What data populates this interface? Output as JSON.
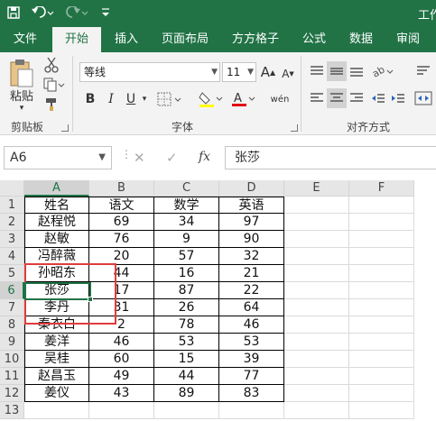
{
  "titlebar": {
    "title": "工作",
    "save_icon": "save-icon",
    "undo_icon": "undo-icon",
    "redo_icon": "redo-icon",
    "customize_icon": "customize-qat-icon"
  },
  "tabs": [
    "文件",
    "开始",
    "插入",
    "页面布局",
    "方方格子",
    "公式",
    "数据",
    "审阅"
  ],
  "active_tab": "开始",
  "ribbon": {
    "clipboard": {
      "paste_label": "粘贴",
      "group_label": "剪贴板"
    },
    "font": {
      "font_name": "等线",
      "font_size": "11",
      "group_label": "字体",
      "bold": "B",
      "italic": "I",
      "underline": "U",
      "grow": "A",
      "shrink": "A",
      "phonetic": "wén"
    },
    "alignment": {
      "group_label": "对齐方式"
    }
  },
  "formula_bar": {
    "name_box": "A6",
    "cancel": "✕",
    "enter": "✓",
    "fx": "fx",
    "value": "张莎"
  },
  "grid": {
    "columns": [
      "A",
      "B",
      "C",
      "D",
      "E",
      "F"
    ],
    "rows": [
      "1",
      "2",
      "3",
      "4",
      "5",
      "6",
      "7",
      "8",
      "9",
      "10",
      "11",
      "12",
      "13"
    ],
    "cells": [
      [
        "姓名",
        "语文",
        "数学",
        "英语"
      ],
      [
        "赵程悦",
        "69",
        "34",
        "97"
      ],
      [
        "赵敏",
        "76",
        "9",
        "90"
      ],
      [
        "冯醉薇",
        "20",
        "57",
        "32"
      ],
      [
        "孙昭东",
        "44",
        "16",
        "21"
      ],
      [
        "张莎",
        "17",
        "87",
        "22"
      ],
      [
        "李丹",
        "31",
        "26",
        "64"
      ],
      [
        "秦衣白",
        "2",
        "78",
        "46"
      ],
      [
        "姜洋",
        "46",
        "53",
        "53"
      ],
      [
        "吴桂",
        "60",
        "15",
        "39"
      ],
      [
        "赵昌玉",
        "49",
        "44",
        "77"
      ],
      [
        "姜仪",
        "43",
        "89",
        "83"
      ]
    ],
    "active_cell": "A6"
  }
}
